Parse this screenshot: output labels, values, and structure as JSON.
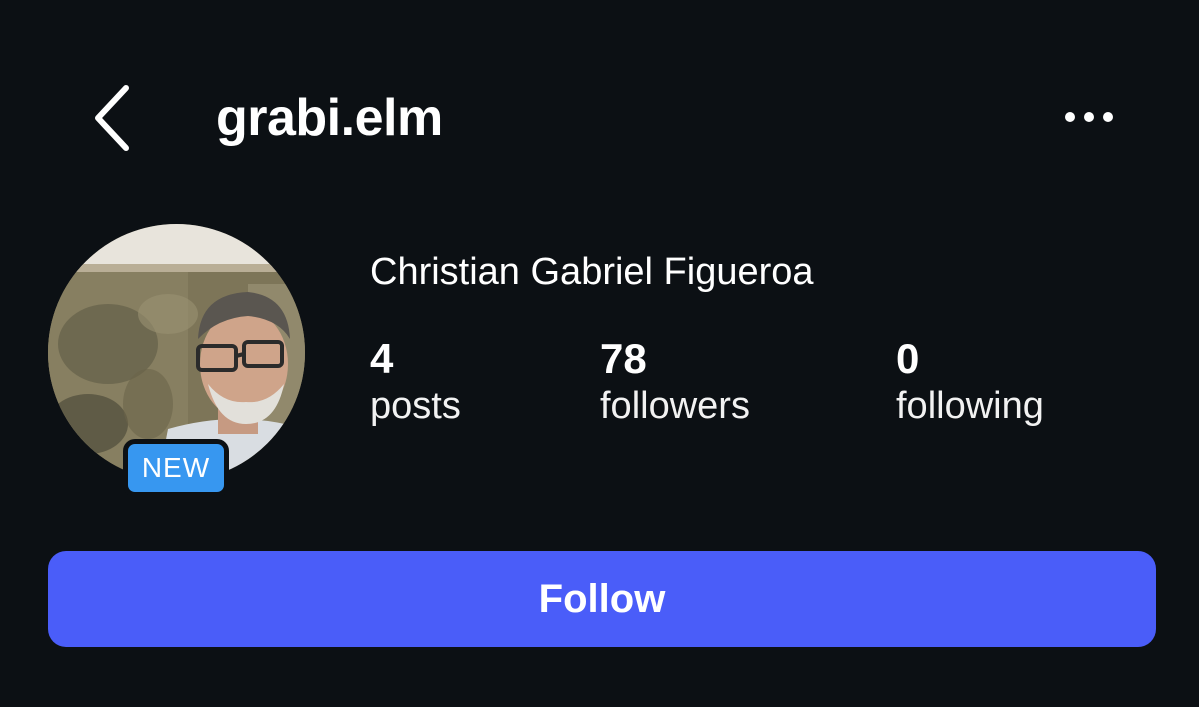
{
  "header": {
    "back_icon": "chevron-left-icon",
    "username": "grabi.elm",
    "more_icon": "ellipsis-horizontal-icon"
  },
  "profile": {
    "avatar_alt": "profile photo",
    "badge": "NEW",
    "full_name": "Christian Gabriel Figueroa",
    "stats": [
      {
        "count": "4",
        "label": "posts"
      },
      {
        "count": "78",
        "label": "followers"
      },
      {
        "count": "0",
        "label": "following"
      }
    ]
  },
  "actions": {
    "follow_label": "Follow"
  },
  "colors": {
    "background": "#0c1014",
    "follow_button": "#4a5df9",
    "badge": "#3797f0",
    "text": "#ffffff"
  }
}
